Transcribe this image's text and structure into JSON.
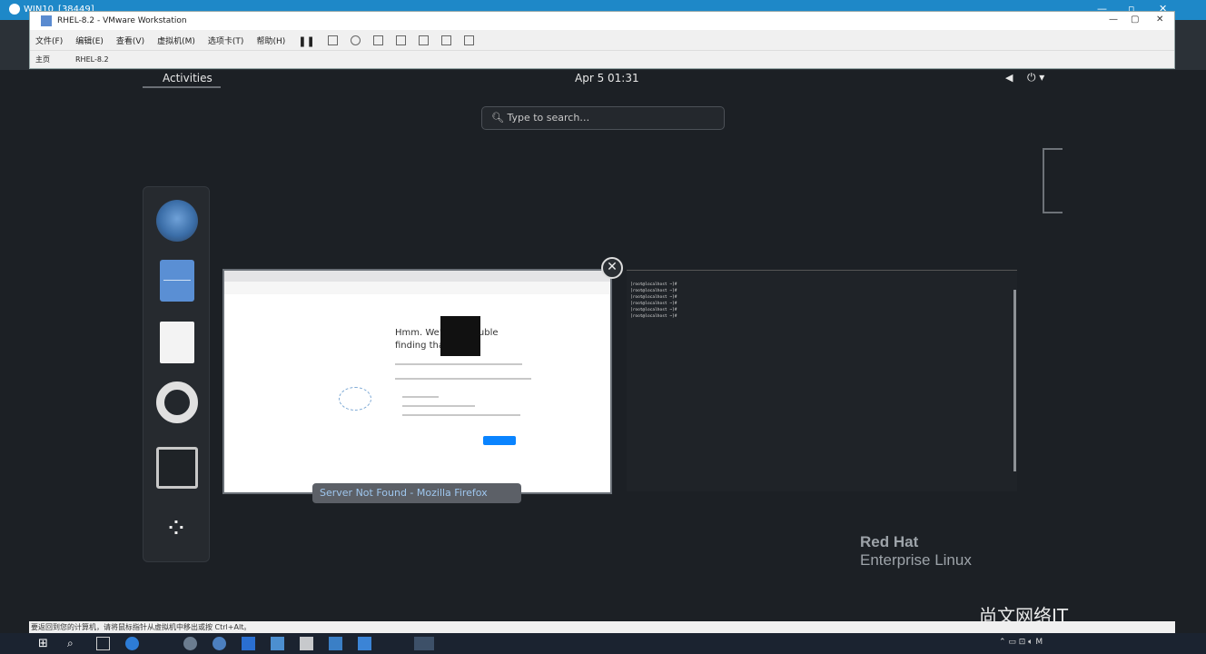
{
  "rdp": {
    "title": "WIN10_[38449]"
  },
  "vmware": {
    "title": "RHEL-8.2 - VMware Workstation",
    "menu": [
      "文件(F)",
      "编辑(E)",
      "查看(V)",
      "虚拟机(M)",
      "选项卡(T)",
      "帮助(H)"
    ],
    "tabs": [
      "主页",
      "RHEL-8.2"
    ]
  },
  "gnome": {
    "activities": "Activities",
    "clock": "Apr 5  01:31",
    "search_placeholder": "Type to search…",
    "window_caption": "Server Not Found - Mozilla Firefox"
  },
  "firefox_preview": {
    "heading_line1": "Hmm. We're … trouble",
    "heading_line2": "finding that …"
  },
  "terminal_preview": {
    "lines": [
      "[root@localhost ~]#",
      "[root@localhost ~]#",
      "[root@localhost ~]#",
      "[root@localhost ~]#",
      "[root@localhost ~]#",
      "[root@localhost ~]# "
    ]
  },
  "branding": {
    "line1": "Red Hat",
    "line2": "Enterprise Linux"
  },
  "watermark": "尚文网络IT",
  "hint": "要返回到您的计算机，请将鼠标指针从虚拟机中移出或按 Ctrl+Alt。"
}
